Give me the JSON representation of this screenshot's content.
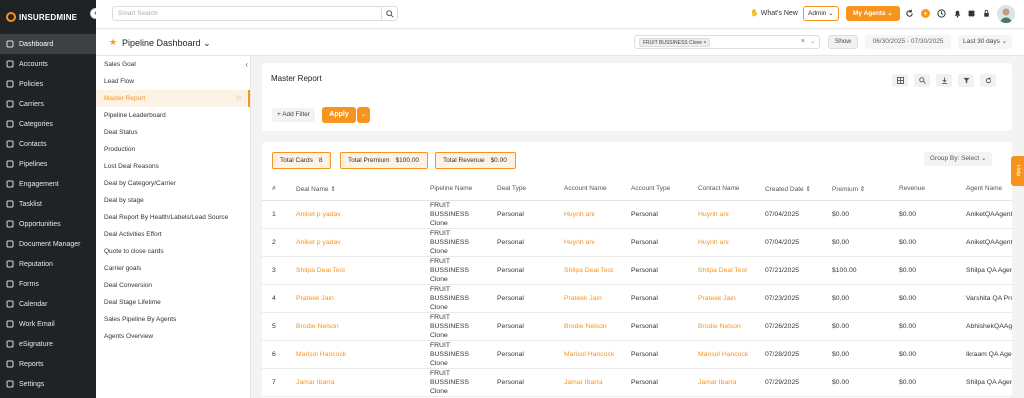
{
  "app": {
    "logo": "INSUREDMINE"
  },
  "sidebar": {
    "items": [
      {
        "label": "Dashboard",
        "icon": "dashboard-icon",
        "active": true
      },
      {
        "label": "Accounts",
        "icon": "user-icon"
      },
      {
        "label": "Policies",
        "icon": "policy-icon"
      },
      {
        "label": "Carriers",
        "icon": "folder-icon"
      },
      {
        "label": "Categories",
        "icon": "tag-icon"
      },
      {
        "label": "Contacts",
        "icon": "contact-icon"
      },
      {
        "label": "Pipelines",
        "icon": "pipeline-icon"
      },
      {
        "label": "Engagement",
        "icon": "megaphone-icon"
      },
      {
        "label": "Tasklist",
        "icon": "list-icon"
      },
      {
        "label": "Opportunities",
        "icon": "opportunity-icon"
      },
      {
        "label": "Document Manager",
        "icon": "document-icon"
      },
      {
        "label": "Reputation",
        "icon": "star-icon"
      },
      {
        "label": "Forms",
        "icon": "form-icon"
      },
      {
        "label": "Calendar",
        "icon": "calendar-icon"
      },
      {
        "label": "Work Email",
        "icon": "mail-icon"
      },
      {
        "label": "eSignature",
        "icon": "signature-icon"
      },
      {
        "label": "Reports",
        "icon": "chart-icon"
      },
      {
        "label": "Settings",
        "icon": "gear-icon"
      }
    ]
  },
  "topbar": {
    "search_placeholder": "Smart Search",
    "whats_new": "What's New",
    "admin_label": "Admin",
    "my_agents_label": "My Agents"
  },
  "header": {
    "title": "Pipeline Dashboard",
    "filter_chip": "FRUIT BUSSINESS Clone",
    "show_label": "Show",
    "date_range": "06/30/2025 - 07/30/2025",
    "period": "Last 30 days"
  },
  "reports": {
    "items": [
      {
        "label": "Sales Goal"
      },
      {
        "label": "Lead Flow"
      },
      {
        "label": "Master Report",
        "active": true
      },
      {
        "label": "Pipeline Leaderboard"
      },
      {
        "label": "Deal Status"
      },
      {
        "label": "Production"
      },
      {
        "label": "Lost Deal Reasons"
      },
      {
        "label": "Deal by Category/Carrier"
      },
      {
        "label": "Deal by stage"
      },
      {
        "label": "Deal Report By Health/Labels/Lead Source"
      },
      {
        "label": "Deal Activities Effort"
      },
      {
        "label": "Quote to close cards"
      },
      {
        "label": "Carrier goals"
      },
      {
        "label": "Deal Conversion"
      },
      {
        "label": "Deal Stage Lifetime"
      },
      {
        "label": "Sales Pipeline By Agents"
      },
      {
        "label": "Agents Overview"
      }
    ]
  },
  "master": {
    "title": "Master Report",
    "add_filter": "+ Add Filter",
    "apply": "Apply"
  },
  "summary": {
    "total_cards_label": "Total Cards",
    "total_cards_value": "8",
    "total_premium_label": "Total Premium",
    "total_premium_value": "$100.00",
    "total_revenue_label": "Total Revenue",
    "total_revenue_value": "$0.00",
    "group_by": "Group By: Select"
  },
  "help_label": "Help",
  "table": {
    "columns": [
      "#",
      "Deal Name ⇕",
      "Pipeline Name",
      "Deal Type",
      "Account Name",
      "Account Type",
      "Contact Name",
      "Created Date ⇕",
      "Premium ⇕",
      "Revenue",
      "Agent Name"
    ],
    "rows": [
      [
        "1",
        "Aniket p yadav",
        "FRUIT BUSSINESS Clone",
        "Personal",
        "Huynh ani",
        "Personal",
        "Huynh ani",
        "07/04/2025",
        "$0.00",
        "$0.00",
        "AniketQAAgent"
      ],
      [
        "2",
        "Aniket p yadav",
        "FRUIT BUSSINESS Clone",
        "Personal",
        "Huynh ani",
        "Personal",
        "Huynh ani",
        "07/04/2025",
        "$0.00",
        "$0.00",
        "AniketQAAgent"
      ],
      [
        "3",
        "Shilpa Deal Test",
        "FRUIT BUSSINESS Clone",
        "Personal",
        "Shilpa Deal Test",
        "Personal",
        "Shilpa Deal Test",
        "07/21/2025",
        "$100.00",
        "$0.00",
        "Shilpa QA Agent"
      ],
      [
        "4",
        "Prateek Jain",
        "FRUIT BUSSINESS Clone",
        "Personal",
        "Prateek Jain",
        "Personal",
        "Prateek Jain",
        "07/23/2025",
        "$0.00",
        "$0.00",
        "Varshita QA Pro"
      ],
      [
        "5",
        "Brodie Nelson",
        "FRUIT BUSSINESS Clone",
        "Personal",
        "Brodie Nelson",
        "Personal",
        "Brodie Nelson",
        "07/26/2025",
        "$0.00",
        "$0.00",
        "AbhishekQAAgent"
      ],
      [
        "6",
        "Marisol Hancock",
        "FRUIT BUSSINESS Clone",
        "Personal",
        "Marisol Hancock",
        "Personal",
        "Marisol Hancock",
        "07/28/2025",
        "$0.00",
        "$0.00",
        "Ikraam QA Agent"
      ],
      [
        "7",
        "Jamar Ibarra",
        "FRUIT BUSSINESS Clone",
        "Personal",
        "Jamar Ibarra",
        "Personal",
        "Jamar Ibarra",
        "07/29/2025",
        "$0.00",
        "$0.00",
        "Shilpa QA Agent"
      ]
    ]
  },
  "colors": {
    "accent": "#f7941d",
    "sidebar": "#1f2326"
  }
}
